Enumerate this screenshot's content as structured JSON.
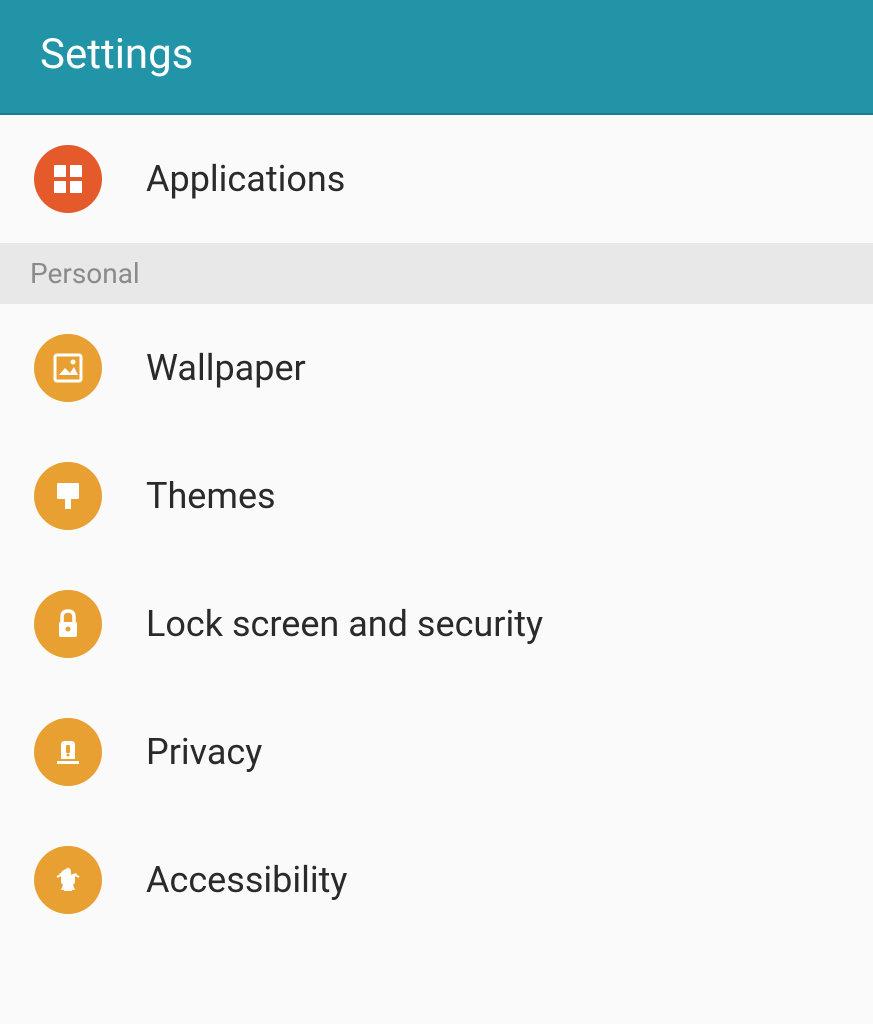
{
  "header": {
    "title": "Settings"
  },
  "items": [
    {
      "label": "Applications"
    }
  ],
  "section": {
    "label": "Personal"
  },
  "personal_items": [
    {
      "label": "Wallpaper"
    },
    {
      "label": "Themes"
    },
    {
      "label": "Lock screen and security"
    },
    {
      "label": "Privacy"
    },
    {
      "label": "Accessibility"
    }
  ]
}
